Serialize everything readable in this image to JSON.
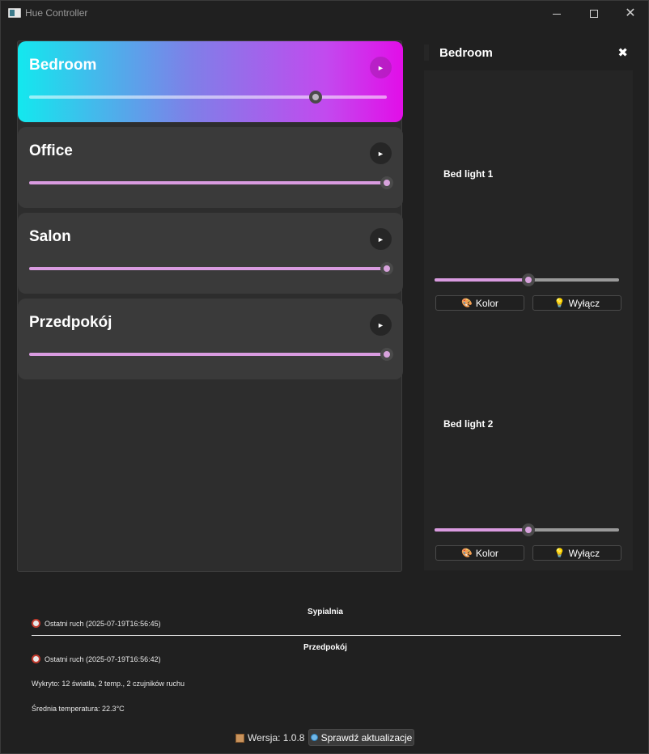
{
  "app": {
    "title": "Hue Controller"
  },
  "rooms": [
    {
      "name": "Bedroom",
      "play_icon": "►",
      "brightness_pct": 80,
      "active": true
    },
    {
      "name": "Office",
      "play_icon": "►",
      "brightness_pct": 100,
      "active": false
    },
    {
      "name": "Salon",
      "play_icon": "►",
      "brightness_pct": 100,
      "active": false
    },
    {
      "name": "Przedpokój",
      "play_icon": "►",
      "brightness_pct": 100,
      "active": false
    }
  ],
  "detail": {
    "title": "Bedroom",
    "close_icon": "✖",
    "lights": [
      {
        "name": "Bed light 1",
        "brightness_pct": 51,
        "color_label": "Kolor",
        "color_icon": "🎨",
        "off_label": "Wyłącz",
        "off_icon": "💡"
      },
      {
        "name": "Bed light 2",
        "brightness_pct": 51,
        "color_label": "Kolor",
        "color_icon": "🎨",
        "off_label": "Wyłącz",
        "off_icon": "💡"
      }
    ]
  },
  "sensors": [
    {
      "name": "Sypialnia",
      "motion": "Ostatni ruch (2025-07-19T16:56:45)"
    },
    {
      "name": "Przedpokój",
      "motion": "Ostatni ruch (2025-07-19T16:56:42)"
    }
  ],
  "info": {
    "detected": "Wykryto: 12 światła, 2 temp., 2 czujników ruchu",
    "avg_temp": "Średnia temperatura: 22.3°C"
  },
  "footer": {
    "version": "Wersja: 1.0.8",
    "update_label": "Sprawdź aktualizacje"
  },
  "colors": {
    "accent": "#d99be0",
    "gradient_start": "#13e8ee",
    "gradient_end": "#e20ee8"
  }
}
